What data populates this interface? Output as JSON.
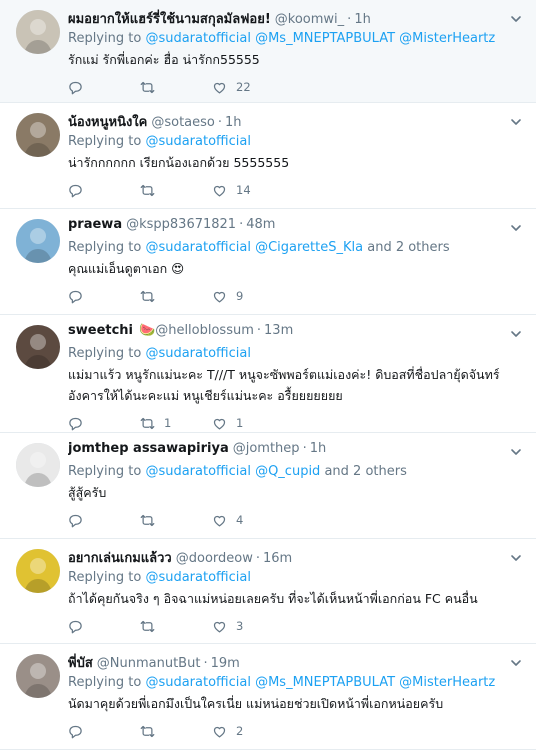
{
  "tweets": [
    {
      "name": "ผมอยากให้แฮร์รี่ใช้นามสกุลมัลฟอย!",
      "handle": "@koomwi_",
      "time": "1h",
      "emoji": "",
      "replying_prefix": "Replying to",
      "replying_to": [
        "@sudaratofficial",
        "@Ms_MNEPTAPBULAT",
        "@MisterHeartz"
      ],
      "others": "",
      "text": "รักแม่ รักพี่เอกค่ะ ฮื่อ น่ารักก55555",
      "text_emoji": "",
      "retweets": "",
      "likes": "22",
      "avatar_color": "#c9c3b6"
    },
    {
      "name": "น้องหนูหนิงใค",
      "handle": "@sotaeso",
      "time": "1h",
      "emoji": "",
      "replying_prefix": "Replying to",
      "replying_to": [
        "@sudaratofficial"
      ],
      "others": "",
      "text": "น่ารักกกกกก เรียกน้องเอกด้วย 5555555",
      "text_emoji": "",
      "retweets": "",
      "likes": "14",
      "avatar_color": "#8a7a66"
    },
    {
      "name": "praewa",
      "handle": "@kspp83671821",
      "time": "48m",
      "emoji": "",
      "replying_prefix": "Replying to",
      "replying_to": [
        "@sudaratofficial",
        "@CigaretteS_Kla"
      ],
      "others": "and 2 others",
      "text": "คุณแม่เอ็นดูตาเอก",
      "text_emoji": "😍",
      "retweets": "",
      "likes": "9",
      "avatar_color": "#7fb2d6"
    },
    {
      "name": "sweetchi",
      "handle": "@helloblossum",
      "time": "13m",
      "emoji": "🍉",
      "replying_prefix": "Replying to",
      "replying_to": [
        "@sudaratofficial"
      ],
      "others": "",
      "text": "แม่มาแร้ว หนูรักแม่นะคะ T///T หนูจะซัพพอร์ตแม่เองค่ะ! ดิบอสที่ชื่อปลายุ้ดจันทร์อังคารให้ได้นะคะแม่ หนูเชียร์แม่นะคะ อรื้ยยยยยยย",
      "text_emoji": "",
      "retweets": "1",
      "likes": "1",
      "avatar_color": "#5c4a40"
    },
    {
      "name": "jomthep assawapiriya",
      "handle": "@jomthep",
      "time": "1h",
      "emoji": "",
      "replying_prefix": "Replying to",
      "replying_to": [
        "@sudaratofficial",
        "@Q_cupid"
      ],
      "others": "and 2 others",
      "text": "สู้สู้ครับ",
      "text_emoji": "",
      "retweets": "",
      "likes": "4",
      "avatar_color": "#e9e9e9"
    },
    {
      "name": "อยากเล่นเกมแล้วว",
      "handle": "@doordeow",
      "time": "16m",
      "emoji": "",
      "replying_prefix": "Replying to",
      "replying_to": [
        "@sudaratofficial"
      ],
      "others": "",
      "text": "ถ้าได้คุยกันจริง ๆ อิจฉาแม่หน่อยเลยครับ ที่จะได้เห็นหน้าพี่เอกก่อน FC คนอื่น",
      "text_emoji": "",
      "retweets": "",
      "likes": "3",
      "avatar_color": "#e0c232"
    },
    {
      "name": "พี่บัส",
      "handle": "@NunmanutBut",
      "time": "19m",
      "emoji": "",
      "replying_prefix": "Replying to",
      "replying_to": [
        "@sudaratofficial",
        "@Ms_MNEPTAPBULAT",
        "@MisterHeartz"
      ],
      "others": "",
      "text": "นัดมาคุยด้วยพี่เอกมึงเป็นใครเนี่ย แม่หน่อยช่วยเปิดหน้าพี่เอกหน่อยครับ",
      "text_emoji": "",
      "retweets": "",
      "likes": "2",
      "avatar_color": "#9a8f88"
    }
  ]
}
